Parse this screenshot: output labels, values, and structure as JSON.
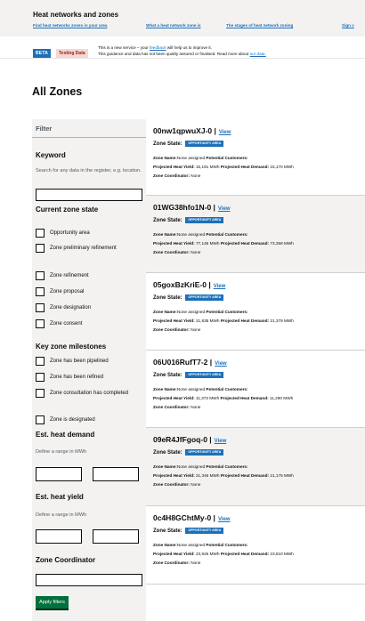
{
  "header": {
    "service_name": "Heat networks and zones",
    "nav": [
      "Find heat networks zones in your area",
      "What a heat network zone is",
      "The stages of heat network zoning",
      "Sign c"
    ]
  },
  "banner": {
    "beta_tag": "BETA",
    "testing_tag": "Testing Data",
    "line1_pre": "This is a new service – your",
    "line1_link": "feedback",
    "line1_post": "will help us to improve it.",
    "line2_pre": "This guidance and data has not been quality assured or finalised. Read more about",
    "line2_link": "our data."
  },
  "page_title": "All Zones",
  "filter": {
    "title": "Filter",
    "keyword_label": "Keyword",
    "keyword_hint": "Search for any data in the register, e.g. location.",
    "keyword_value": "",
    "zone_state_label": "Current zone state",
    "zone_states": [
      "Opportunity area",
      "Zone preliminary refinement",
      "Zone refinement",
      "Zone proposal",
      "Zone designation",
      "Zone consent"
    ],
    "milestones_label": "Key zone milestones",
    "milestones": [
      "Zone has been pipelined",
      "Zone has been refined",
      "Zone consultation has completed",
      "Zone is designated"
    ],
    "demand_label": "Est. heat demand",
    "demand_hint": "Define a range in MWh",
    "yield_label": "Est. heat yield",
    "yield_hint": "Define a range in MWh",
    "coordinator_label": "Zone Coordinator",
    "apply_label": "Apply filters"
  },
  "zones": [
    {
      "id": "00nw1qpwuXJ-0 |",
      "view": "View",
      "state_label": "Zone State:",
      "state": "OPPORTUNITY AREA",
      "name_label": "Zone Name:",
      "name": "None assigned",
      "customers_label": "Potential Customers:",
      "yield_label": "Projected Heat Yield:",
      "yield": "15,191 MWh",
      "demand_label": "Projected Heat Demand:",
      "demand": "15,170 MWh",
      "coord_label": "Zone Coordinator:",
      "coordinator": "None"
    },
    {
      "id": "01WG38hfo1N-0 |",
      "view": "View",
      "state_label": "Zone State:",
      "state": "OPPORTUNITY AREA",
      "name_label": "Zone Name:",
      "name": "None assigned",
      "customers_label": "Potential Customers:",
      "yield_label": "Projected Heat Yield:",
      "yield": "77,146 MWh",
      "demand_label": "Projected Heat Demand:",
      "demand": "73,358 MWh",
      "coord_label": "Zone Coordinator:",
      "coordinator": "None"
    },
    {
      "id": "05goxBzKriE-0 |",
      "view": "View",
      "state_label": "Zone State:",
      "state": "OPPORTUNITY AREA",
      "name_label": "Zone Name:",
      "name": "None assigned",
      "customers_label": "Potential Customers:",
      "yield_label": "Projected Heat Yield:",
      "yield": "21,835 MWh",
      "demand_label": "Projected Heat Demand:",
      "demand": "21,379 MWh",
      "coord_label": "Zone Coordinator:",
      "coordinator": "None"
    },
    {
      "id": "06U016RufT7-2 |",
      "view": "View",
      "state_label": "Zone State:",
      "state": "OPPORTUNITY AREA",
      "name_label": "Zone Name:",
      "name": "None assigned",
      "customers_label": "Potential Customers:",
      "yield_label": "Projected Heat Yield:",
      "yield": "11,372 MWh",
      "demand_label": "Projected Heat Demand:",
      "demand": "11,290 MWh",
      "coord_label": "Zone Coordinator:",
      "coordinator": "None"
    },
    {
      "id": "09eR4JfFgoq-0 |",
      "view": "View",
      "state_label": "Zone State:",
      "state": "OPPORTUNITY AREA",
      "name_label": "Zone Name:",
      "name": "None assigned",
      "customers_label": "Potential Customers:",
      "yield_label": "Projected Heat Yield:",
      "yield": "21,346 MWh",
      "demand_label": "Projected Heat Demand:",
      "demand": "21,175 MWh",
      "coord_label": "Zone Coordinator:",
      "coordinator": "None"
    },
    {
      "id": "0c4H8GChtMy-0 |",
      "view": "View",
      "state_label": "Zone State:",
      "state": "OPPORTUNITY AREA",
      "name_label": "Zone Name:",
      "name": "None assigned",
      "customers_label": "Potential Customers:",
      "yield_label": "Projected Heat Yield:",
      "yield": "23,926 MWh",
      "demand_label": "Projected Heat Demand:",
      "demand": "23,810 MWh",
      "coord_label": "Zone Coordinator:",
      "coordinator": "None"
    }
  ]
}
